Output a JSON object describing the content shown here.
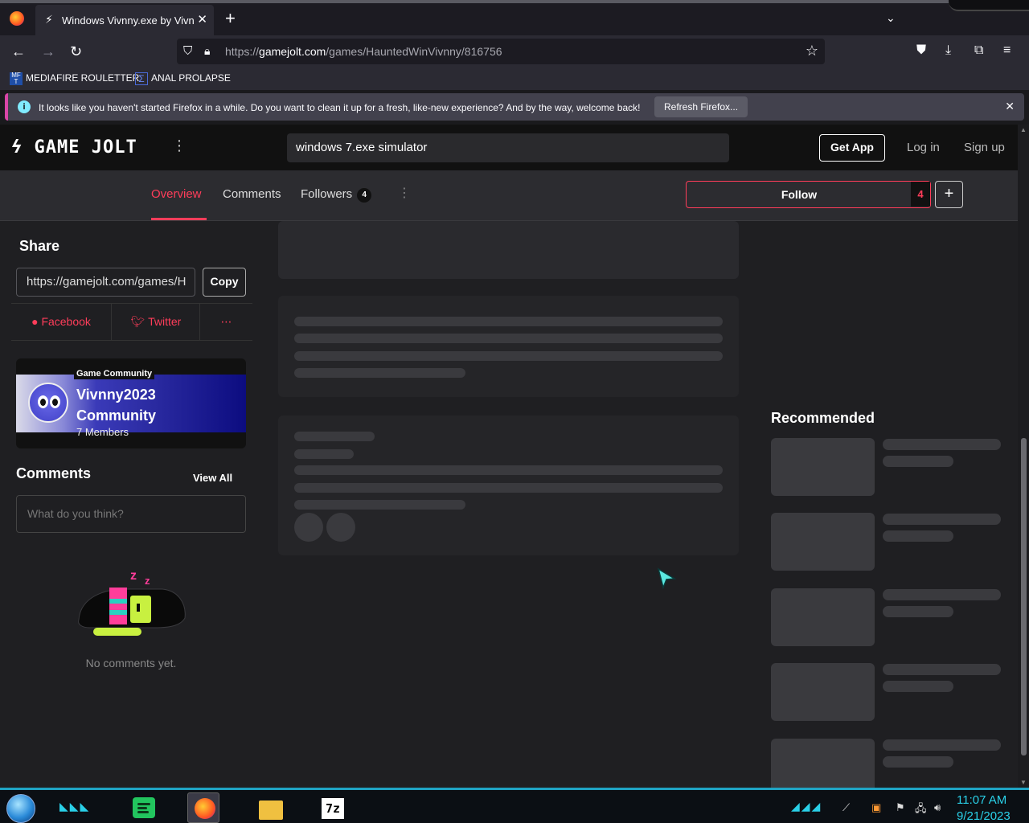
{
  "browser": {
    "tab_title": "Windows Vivnny.exe by Vivnny",
    "new_tab": "+",
    "url_prefix": "https://",
    "url_host": "gamejolt.com",
    "url_path": "/games/HauntedWinVivnny/816756",
    "bookmarks": [
      {
        "label": "MEDIAFIRE ROULETTER",
        "icon": "mediafire-icon"
      },
      {
        "label": "ANAL PROLAPSE",
        "icon": "sigma-icon"
      }
    ],
    "notification": {
      "message": "It looks like you haven't started Firefox in a while. Do you want to clean it up for a fresh, like-new experience? And by the way, welcome back!",
      "button": "Refresh Firefox..."
    }
  },
  "header": {
    "logo": "GAME JOLT",
    "search_value": "windows 7.exe simulator",
    "get_app": "Get App",
    "login": "Log in",
    "signup": "Sign up"
  },
  "subnav": {
    "tabs": [
      {
        "label": "Overview",
        "active": true
      },
      {
        "label": "Comments",
        "active": false
      },
      {
        "label": "Followers",
        "active": false
      }
    ],
    "followers_count": "4",
    "follow_label": "Follow",
    "follow_count": "4"
  },
  "share": {
    "title": "Share",
    "url": "https://gamejolt.com/games/H",
    "copy": "Copy",
    "facebook": "Facebook",
    "twitter": "Twitter",
    "more": "⋯"
  },
  "community": {
    "tag": "Game Community",
    "name": "Vivnny2023 Community",
    "members": "7 Members"
  },
  "comments": {
    "title": "Comments",
    "view_all": "View All",
    "placeholder": "What do you think?",
    "empty": "No comments yet."
  },
  "recommended": {
    "title": "Recommended"
  },
  "taskbar": {
    "time": "11:07 AM",
    "date": "9/21/2023"
  },
  "colors": {
    "accent": "#ff3d5a",
    "taskbar_accent": "#2ad0e8"
  }
}
